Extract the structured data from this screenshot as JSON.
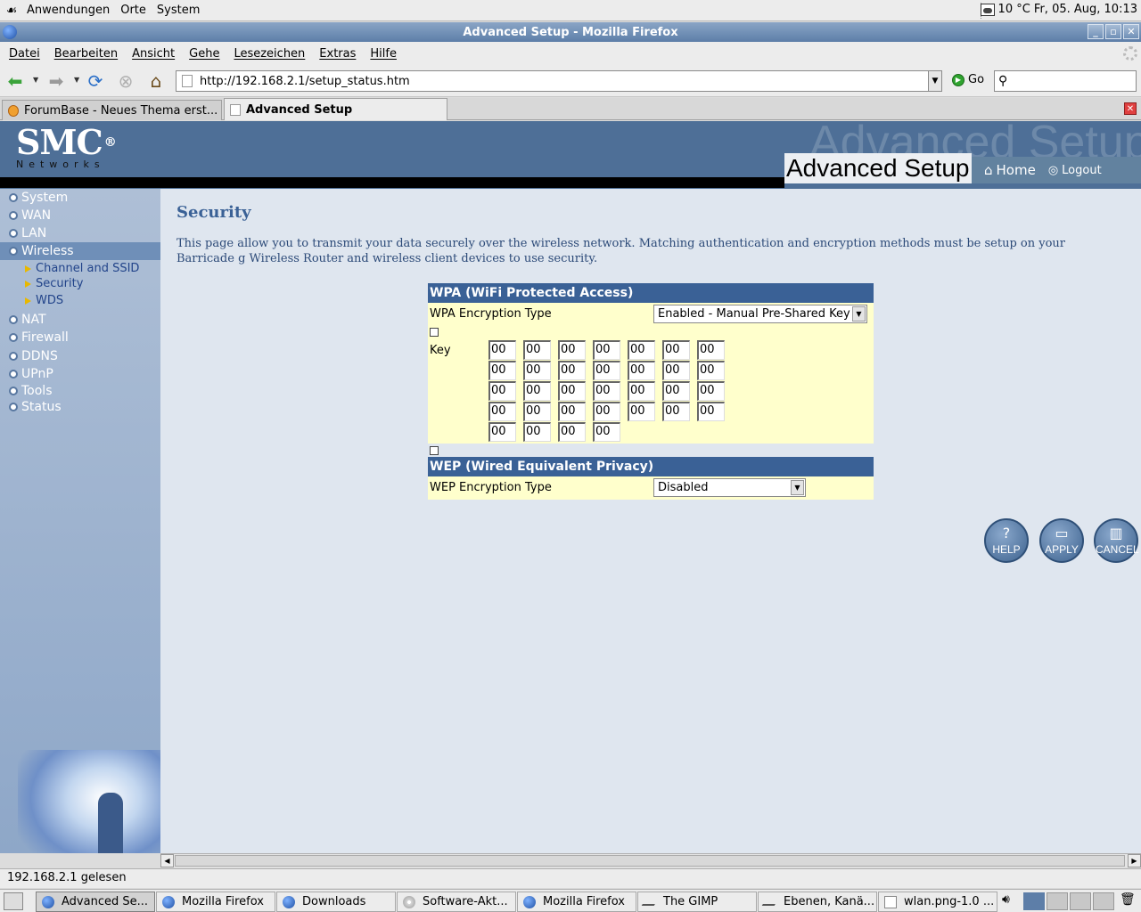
{
  "top_panel": {
    "menus": [
      "Anwendungen",
      "Orte",
      "System"
    ],
    "clock": "10 °C Fr, 05. Aug, 10:13"
  },
  "window": {
    "title": "Advanced Setup - Mozilla Firefox",
    "menu": [
      "Datei",
      "Bearbeiten",
      "Ansicht",
      "Gehe",
      "Lesezeichen",
      "Extras",
      "Hilfe"
    ]
  },
  "navbar": {
    "url": "http://192.168.2.1/setup_status.htm",
    "go_label": "Go"
  },
  "tabs": [
    {
      "label": "ForumBase - Neues Thema erst...",
      "active": false
    },
    {
      "label": "Advanced Setup",
      "active": true
    }
  ],
  "page_header": {
    "logo": "SMC",
    "logo_sub": "Networks",
    "watermark": "Advanced Setup",
    "title": "Advanced Setup",
    "home_label": "Home",
    "logout_label": "Logout"
  },
  "sidebar": {
    "items": [
      "System",
      "WAN",
      "LAN",
      "Wireless",
      "NAT",
      "Firewall",
      "DDNS",
      "UPnP",
      "Tools",
      "Status"
    ],
    "active": "Wireless",
    "subitems": [
      "Channel and SSID",
      "Security",
      "WDS"
    ]
  },
  "main": {
    "title": "Security",
    "description": "This page allow you to transmit your data securely over the wireless network. Matching authentication and encryption methods must be setup on your Barricade g Wireless Router and wireless client devices to use security."
  },
  "wpa": {
    "heading": "WPA (WiFi Protected Access)",
    "type_label": "WPA Encryption Type",
    "type_value": "Enabled - Manual Pre-Shared Key",
    "key_label": "Key",
    "key_rows": [
      [
        "00",
        "00",
        "00",
        "00",
        "00",
        "00",
        "00"
      ],
      [
        "00",
        "00",
        "00",
        "00",
        "00",
        "00",
        "00"
      ],
      [
        "00",
        "00",
        "00",
        "00",
        "00",
        "00",
        "00"
      ],
      [
        "00",
        "00",
        "00",
        "00",
        "00",
        "00",
        "00"
      ],
      [
        "00",
        "00",
        "00",
        "00"
      ]
    ]
  },
  "wep": {
    "heading": "WEP (Wired Equivalent Privacy)",
    "type_label": "WEP Encryption Type",
    "type_value": "Disabled"
  },
  "action_buttons": {
    "help": "HELP",
    "apply": "APPLY",
    "cancel": "CANCEL"
  },
  "statusbar": {
    "text": "192.168.2.1 gelesen"
  },
  "taskbar": {
    "tasks": [
      "Advanced Se...",
      "Mozilla Firefox",
      "Downloads",
      "Software-Akt...",
      "Mozilla Firefox",
      "The GIMP",
      "Ebenen, Kanä...",
      "wlan.png-1.0 ..."
    ]
  }
}
